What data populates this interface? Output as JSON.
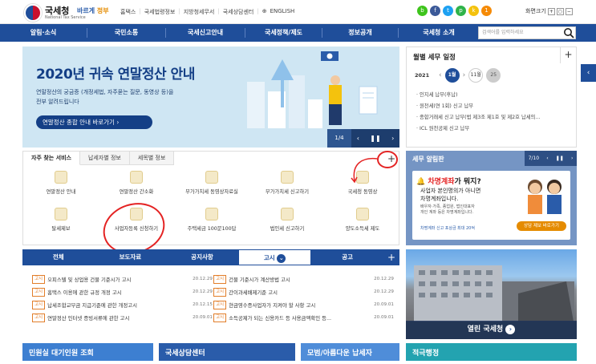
{
  "header": {
    "logo_text": "국세청",
    "logo_sub": "National Tax Service",
    "gov_badge_1": "바르게 ",
    "gov_badge_2": "정부",
    "links": [
      "홈택스",
      "국세법령정보",
      "지방청세무서",
      "국세상담센터",
      "ENGLISH"
    ],
    "screen_size_label": "화면크기",
    "alert_count": "1"
  },
  "nav": {
    "items": [
      "알림·소식",
      "국민소통",
      "국세신고안내",
      "국세정책/제도",
      "정보공개",
      "국세청 소개"
    ],
    "search_placeholder": "검색어를 입력하세요"
  },
  "banner": {
    "title": "2020년 귀속 연말정산 안내",
    "desc": "연말정산의 궁금증 (개정세법, 자주묻는 질문, 동영상 등)을\n전부 알려드립니다",
    "button": "연말정산 종합 안내 바로가기",
    "counter": "1/4"
  },
  "monthly": {
    "title": "월별 세무 일정",
    "year": "2021",
    "months": [
      "1월",
      "11월",
      "25"
    ],
    "items": [
      "· 인지세 납부(후납)",
      "· 원천세(연 1회) 신고 납부",
      "· 종합거래세 신고 납부(법 제3조 제1호 및 제2호 납세의...",
      "· ICL 원천공제 신고 납부"
    ]
  },
  "favorites": {
    "tabs": [
      "자주 찾는 서비스",
      "납세자별 정보",
      "세목별 정보"
    ],
    "items": [
      "연말정산 안내",
      "연말정산 간소화",
      "부가가치세 동영상자료실",
      "부가가치세 신고하기",
      "국세청 동영상",
      "탈세제보",
      "사업자등록 신청하기",
      "주택세금 100문100답",
      "법인세 신고하기",
      "양도소득세 제도"
    ]
  },
  "notice_tabs": [
    "전체",
    "보도자료",
    "공지사항",
    "고시",
    "공고"
  ],
  "notices_left": [
    {
      "tag": "고시",
      "title": "오피스텔 및 상업용 건물 기준시가 고시",
      "date": "20.12.29"
    },
    {
      "tag": "고시",
      "title": "홈택스 이용에 관한 규정 개정 고시",
      "date": "20.12.29"
    },
    {
      "tag": "고시",
      "title": "납세조합교부금 지급기준에 관한 개정고시",
      "date": "20.12.15"
    },
    {
      "tag": "고시",
      "title": "연말정산 인터넷 증빙서류에 관한 고시",
      "date": "20.09.01"
    }
  ],
  "notices_right": [
    {
      "tag": "고시",
      "title": "건물 기준시가 계산방법 고시",
      "date": "20.12.29"
    },
    {
      "tag": "고시",
      "title": "간이과세배제기준 고시",
      "date": "20.12.29"
    },
    {
      "tag": "고시",
      "title": "현금영수증사업자가 지켜야 할 사항 고시",
      "date": "20.09.01"
    },
    {
      "tag": "고시",
      "title": "소득공제가 되는 신용카드 등 사용금액확인 등...",
      "date": "20.09.01"
    }
  ],
  "alarm": {
    "title": "세무 알림판",
    "counter": "7/10",
    "card_title_1": "차명계좌",
    "card_title_2": "가 뭐지?",
    "card_desc": "사업자 본인명의가 아니면\n차명계좌입니다.",
    "card_note": "배우자·가족, 종업원, 법인대표자\n개인 계좌 등은 차명계좌입니다.",
    "card_footer": "차명계좌 신고 포상금 최대 20억",
    "card_button": "상담 제보 바로가기"
  },
  "photo_caption": "열린 국세청",
  "bottom_boxes": [
    "민원실 대기인원 조회",
    "국세상담센터",
    "모범/아름다운 납세자",
    "적극행정"
  ]
}
